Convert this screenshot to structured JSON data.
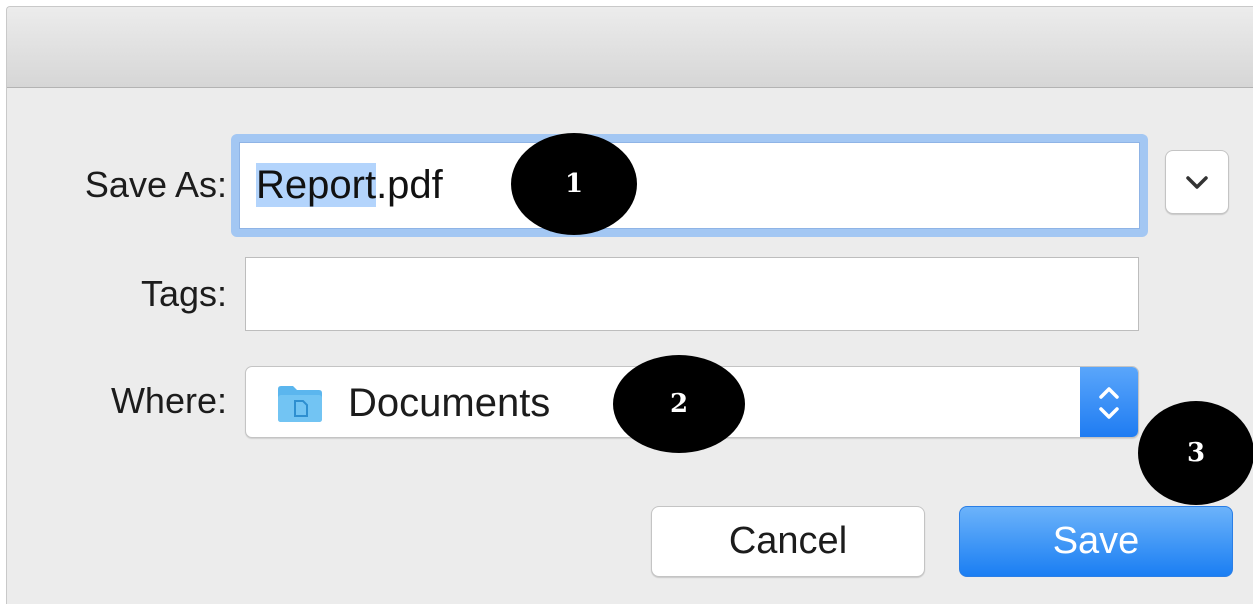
{
  "dialog": {
    "saveas_label": "Save As:",
    "saveas_selected": "Report",
    "saveas_extension": ".pdf",
    "tags_label": "Tags:",
    "tags_value": "",
    "where_label": "Where:",
    "where_value": "Documents",
    "cancel_label": "Cancel",
    "save_label": "Save"
  },
  "annotations": [
    "1",
    "2",
    "3"
  ],
  "icons": {
    "expand": "chevron-down-icon",
    "folder": "folder-icon",
    "stepper": "up-down-chevron-icon"
  },
  "colors": {
    "accent": "#1f7cf2",
    "focus_ring": "#a3c7f3",
    "selection": "#b3d4fc",
    "folder": "#5bb6ee"
  }
}
